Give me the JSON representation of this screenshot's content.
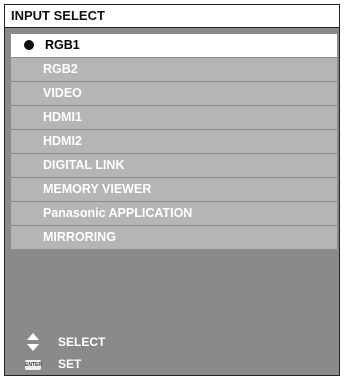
{
  "window": {
    "title": "INPUT SELECT"
  },
  "inputs": [
    {
      "label": "RGB1",
      "selected": true
    },
    {
      "label": "RGB2",
      "selected": false
    },
    {
      "label": "VIDEO",
      "selected": false
    },
    {
      "label": "HDMI1",
      "selected": false
    },
    {
      "label": "HDMI2",
      "selected": false
    },
    {
      "label": "DIGITAL LINK",
      "selected": false
    },
    {
      "label": "MEMORY VIEWER",
      "selected": false
    },
    {
      "label": "Panasonic APPLICATION",
      "selected": false
    },
    {
      "label": "MIRRORING",
      "selected": false
    }
  ],
  "footer": {
    "select_label": "SELECT",
    "set_label": "SET",
    "enter_key_text": "ENTER",
    "select_icon": "up-down-arrows-icon",
    "set_icon": "enter-key-icon"
  },
  "colors": {
    "panel_bg": "#8a8a8a",
    "item_bg": "#b5b5b5",
    "selected_bg": "#ffffff"
  }
}
